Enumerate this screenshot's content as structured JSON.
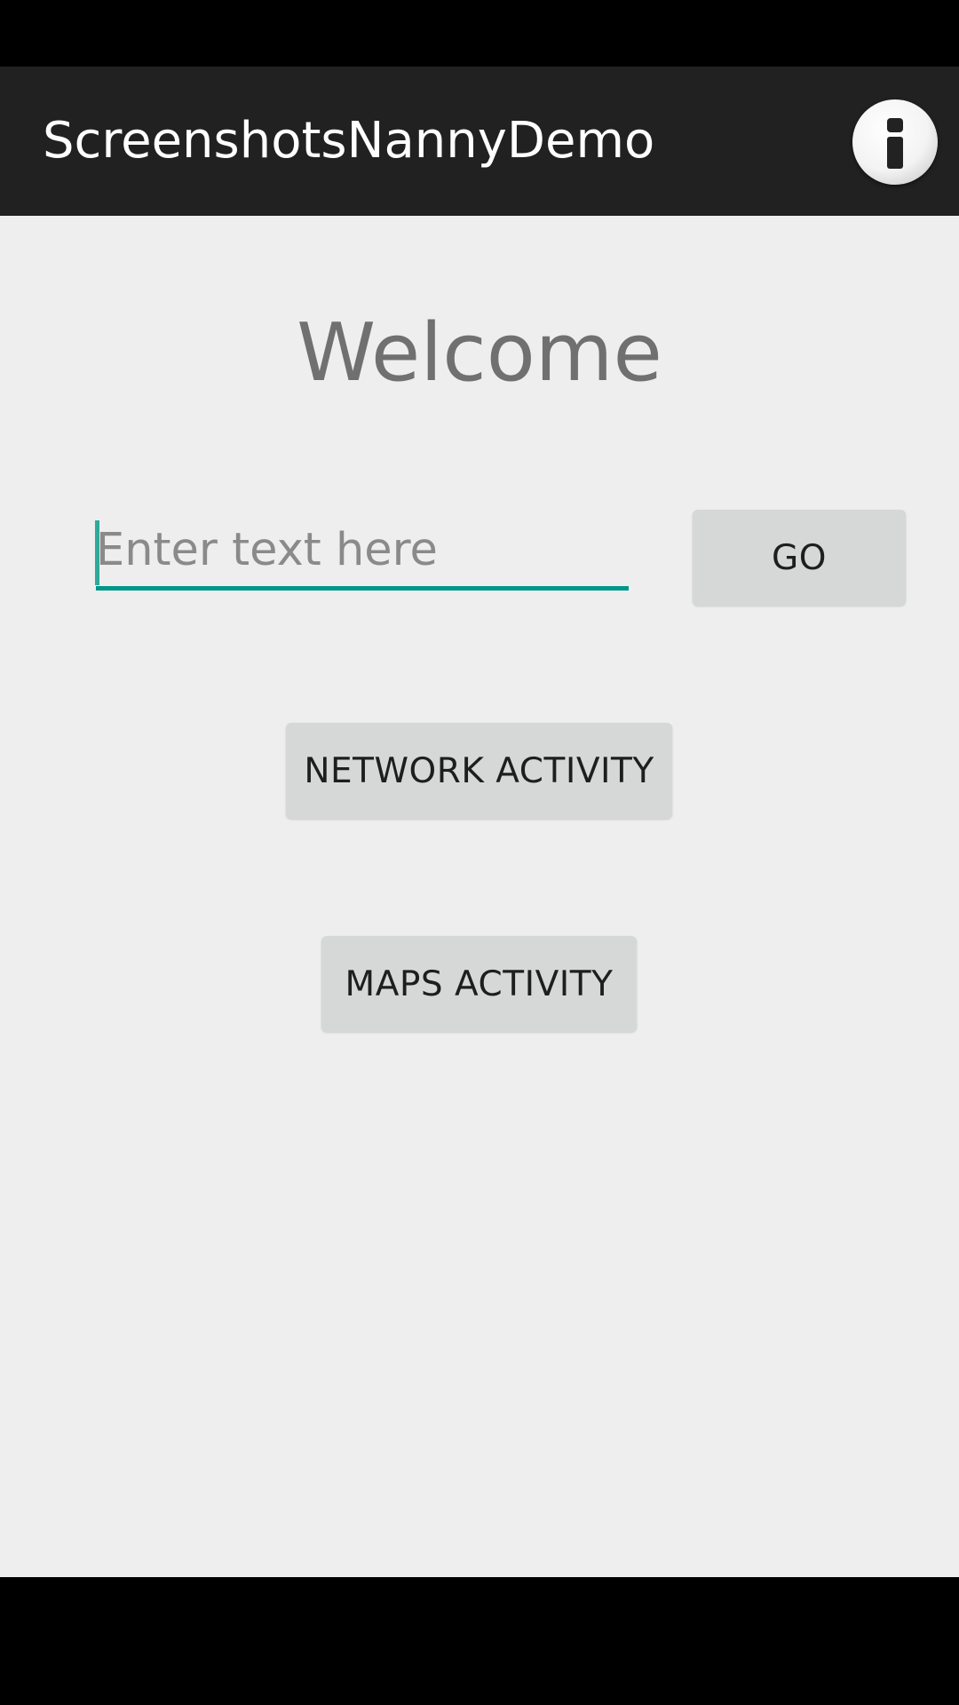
{
  "app_bar": {
    "title": "ScreenshotsNannyDemo",
    "info_icon": "info-icon"
  },
  "main": {
    "heading": "Welcome",
    "text_input": {
      "placeholder": "Enter text here",
      "value": ""
    },
    "go_button_label": "GO",
    "network_button_label": "NETWORK ACTIVITY",
    "maps_button_label": "MAPS ACTIVITY"
  },
  "colors": {
    "app_bar_bg": "#212121",
    "content_bg": "#eeeeee",
    "accent": "#009688",
    "button_bg": "#d6d7d7",
    "heading_text": "#707070"
  }
}
